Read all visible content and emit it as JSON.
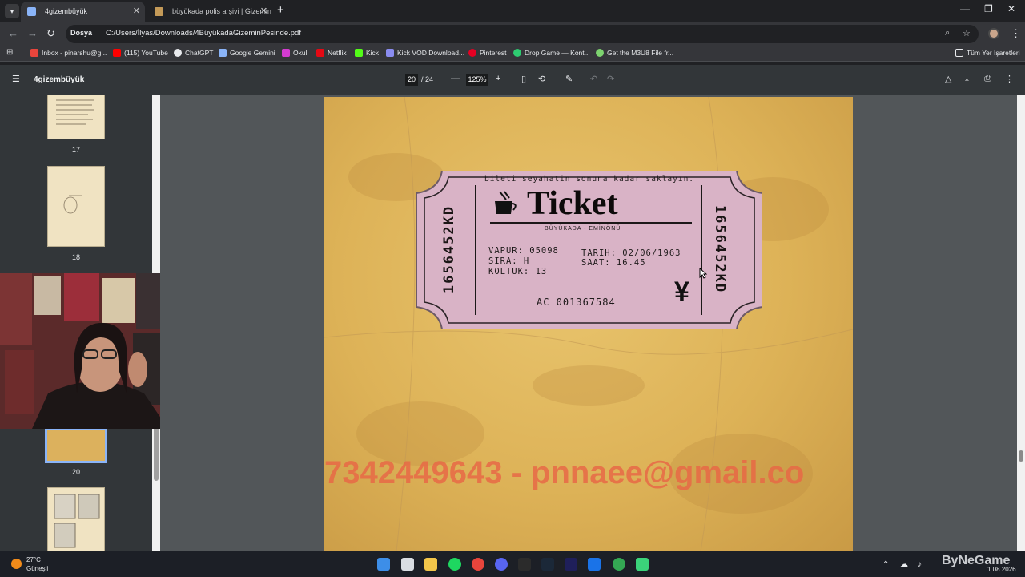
{
  "browser": {
    "tabs": [
      {
        "title": "4gizembüyük",
        "active": true
      },
      {
        "title": "büyükada polis arşivi | Gizemin",
        "active": false
      }
    ],
    "address": {
      "security_label": "Dosya",
      "url": "C:/Users/İlyas/Downloads/4BüyükadaGizeminPesinde.pdf"
    },
    "bookmarks": [
      {
        "label": "Inbox - pinarshu@g...",
        "color": "#e8453c"
      },
      {
        "label": "(115) YouTube",
        "color": "#ff0000"
      },
      {
        "label": "ChatGPT",
        "color": "#e8eaed"
      },
      {
        "label": "Google Gemini",
        "color": "#8ab4f8"
      },
      {
        "label": "Okul",
        "color": "#d33bd0"
      },
      {
        "label": "Netflix",
        "color": "#e50914"
      },
      {
        "label": "Kick",
        "color": "#53fc18"
      },
      {
        "label": "Kick VOD Download...",
        "color": "#8a8cf0"
      },
      {
        "label": "Pinterest",
        "color": "#e60023"
      },
      {
        "label": "Drop Game — Kont...",
        "color": "#2ecc71"
      },
      {
        "label": "Get the M3U8 File fr...",
        "color": "#7dd36f"
      }
    ],
    "all_bookmarks_label": "Tüm Yer İşaretleri"
  },
  "pdf": {
    "title": "4gizembüyük",
    "current_page": "20",
    "total_pages": "/ 24",
    "zoom": "125%"
  },
  "thumbnails": [
    {
      "number": "17"
    },
    {
      "number": "18"
    },
    {
      "number": "20",
      "selected": true
    }
  ],
  "ticket": {
    "top_note": "bileti seyahatin sonuna kadar saklayın.",
    "title": "Ticket",
    "subtitle": "BÜYÜKADA - EMİNÖNÜ",
    "side_code": "1656452KD",
    "vapur": "VAPUR: 05098",
    "sira": "SIRA: H",
    "koltuk": "KOLTUK: 13",
    "tarih": "TARIH: 02/06/1963",
    "saat": "SAAT: 16.45",
    "serial": "AC 001367584",
    "symbol": "¥"
  },
  "watermark": "7342449643 - pnnaee@gmail.co",
  "taskbar": {
    "weather_temp": "27°C",
    "weather_desc": "Güneşli",
    "clock_date": "1.08.2026",
    "watermark_text": "ByNeGame"
  },
  "colors": {
    "browser_bg": "#202124",
    "toolbar_bg": "#35363a",
    "pdf_toolbar": "#323639",
    "viewer_bg": "#525659",
    "ticket_pink": "#d9b3c6",
    "watermark_red": "#e86646"
  },
  "icons": [
    "menu-icon",
    "back-icon",
    "forward-icon",
    "reload-icon",
    "zoom-icon",
    "star-icon",
    "print-icon",
    "download-icon",
    "rotate-icon",
    "fit-icon",
    "undo-icon",
    "redo-icon",
    "windows-icon",
    "search-icon"
  ]
}
